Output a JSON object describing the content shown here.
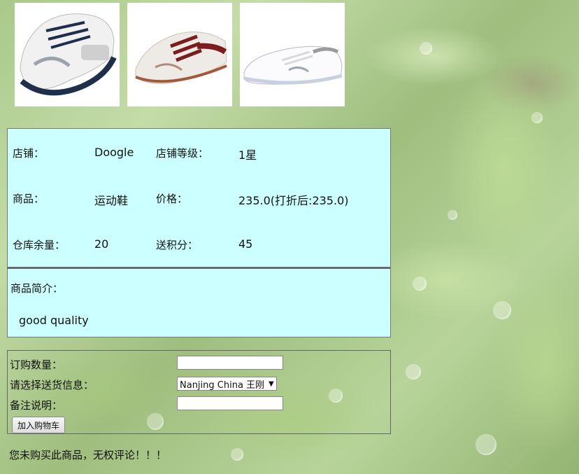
{
  "gallery": {
    "images": [
      "white-navy-sneaker",
      "white-burgundy-sneaker",
      "white-grey-low-sneaker"
    ]
  },
  "info": {
    "shop_label": "店铺：",
    "shop_value": "Doogle",
    "level_label": "店铺等级：",
    "level_value": "1星",
    "product_label": "商品：",
    "product_value": "运动鞋",
    "price_label": "价格：",
    "price_value": "235.0(打折后:235.0)",
    "stock_label": "仓库余量：",
    "stock_value": "20",
    "points_label": "送积分：",
    "points_value": "45"
  },
  "description": {
    "title": "商品简介：",
    "text": "good quality"
  },
  "order": {
    "quantity_label": "订购数量：",
    "quantity_value": "",
    "delivery_label": "请选择送货信息：",
    "delivery_selected": "Nanjing China 王刚",
    "remark_label": "备注说明：",
    "remark_value": "",
    "add_to_cart_label": "加入购物车"
  },
  "notice": "您未购买此商品，无权评论！！！",
  "colors": {
    "panel_bg": "#ccffff",
    "border": "#777777"
  }
}
